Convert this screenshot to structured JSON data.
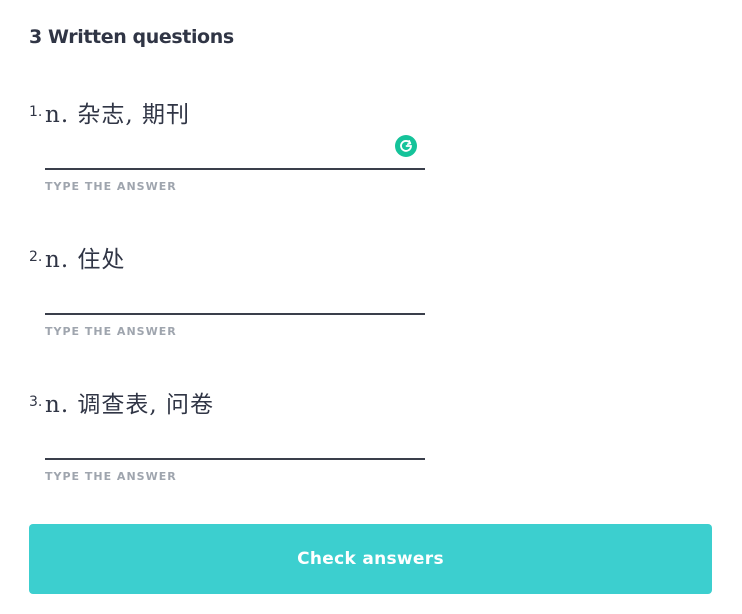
{
  "section": {
    "title": "3 Written questions"
  },
  "questions": [
    {
      "number": "1.",
      "prompt": "n. 杂志, 期刊",
      "answer": "",
      "label": "TYPE THE ANSWER"
    },
    {
      "number": "2.",
      "prompt": "n. 住处",
      "answer": "",
      "label": "TYPE THE ANSWER"
    },
    {
      "number": "3.",
      "prompt": "n. 调查表, 问卷",
      "answer": "",
      "label": "TYPE THE ANSWER"
    }
  ],
  "grammarly": {
    "icon": "grammarly-icon",
    "color": "#15c39a"
  },
  "check_button": {
    "label": "Check answers",
    "color": "#3ccfcf"
  }
}
